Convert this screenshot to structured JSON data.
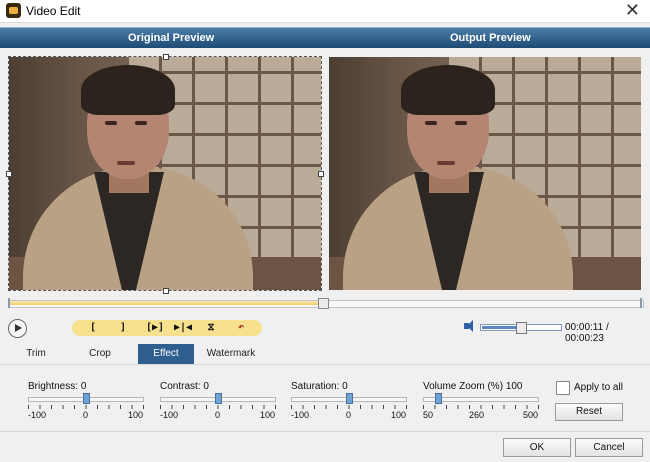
{
  "window": {
    "title": "Video Edit",
    "close_glyph": "✕"
  },
  "header": {
    "original_label": "Original Preview",
    "output_label": "Output Preview"
  },
  "playback": {
    "seek_progress": 0.49,
    "volume_level": 0.5,
    "time_current": "00:00:11",
    "time_total": " / 00:00:23",
    "edit_buttons": [
      {
        "label": "[",
        "icon": "set-start-icon"
      },
      {
        "label": "]",
        "icon": "set-end-icon"
      },
      {
        "label": "[▶]",
        "icon": "play-segment-icon"
      },
      {
        "label": "▶|◀",
        "icon": "split-icon"
      },
      {
        "label": "⧖",
        "icon": "hourglass-icon"
      },
      {
        "label": "↶",
        "icon": "undo-icon"
      }
    ]
  },
  "tabs": [
    {
      "label": "Trim"
    },
    {
      "label": "Crop"
    },
    {
      "label": "Effect",
      "active": true
    },
    {
      "label": "Watermark"
    }
  ],
  "effect": {
    "brightness": {
      "label": "Brightness:",
      "value": "0",
      "min": "-100",
      "mid": "0",
      "max": "100",
      "fraction": 0.5
    },
    "contrast": {
      "label": "Contrast:",
      "value": "0",
      "min": "-100",
      "mid": "0",
      "max": "100",
      "fraction": 0.5
    },
    "saturation": {
      "label": "Saturation:",
      "value": "0",
      "min": "-100",
      "mid": "0",
      "max": "100",
      "fraction": 0.5
    },
    "volume_zoom": {
      "label": "Volume Zoom (%)",
      "value": "100",
      "min": "50",
      "mid": "260",
      "max": "500",
      "fraction": 0.11
    },
    "apply_to_all": "Apply to all",
    "reset": "Reset"
  },
  "footer": {
    "ok": "OK",
    "cancel": "Cancel"
  },
  "colors": {
    "header_bar": "#2f5f8f",
    "seek_fill": "#f2c964",
    "active_tab": "#2f5f8f"
  }
}
